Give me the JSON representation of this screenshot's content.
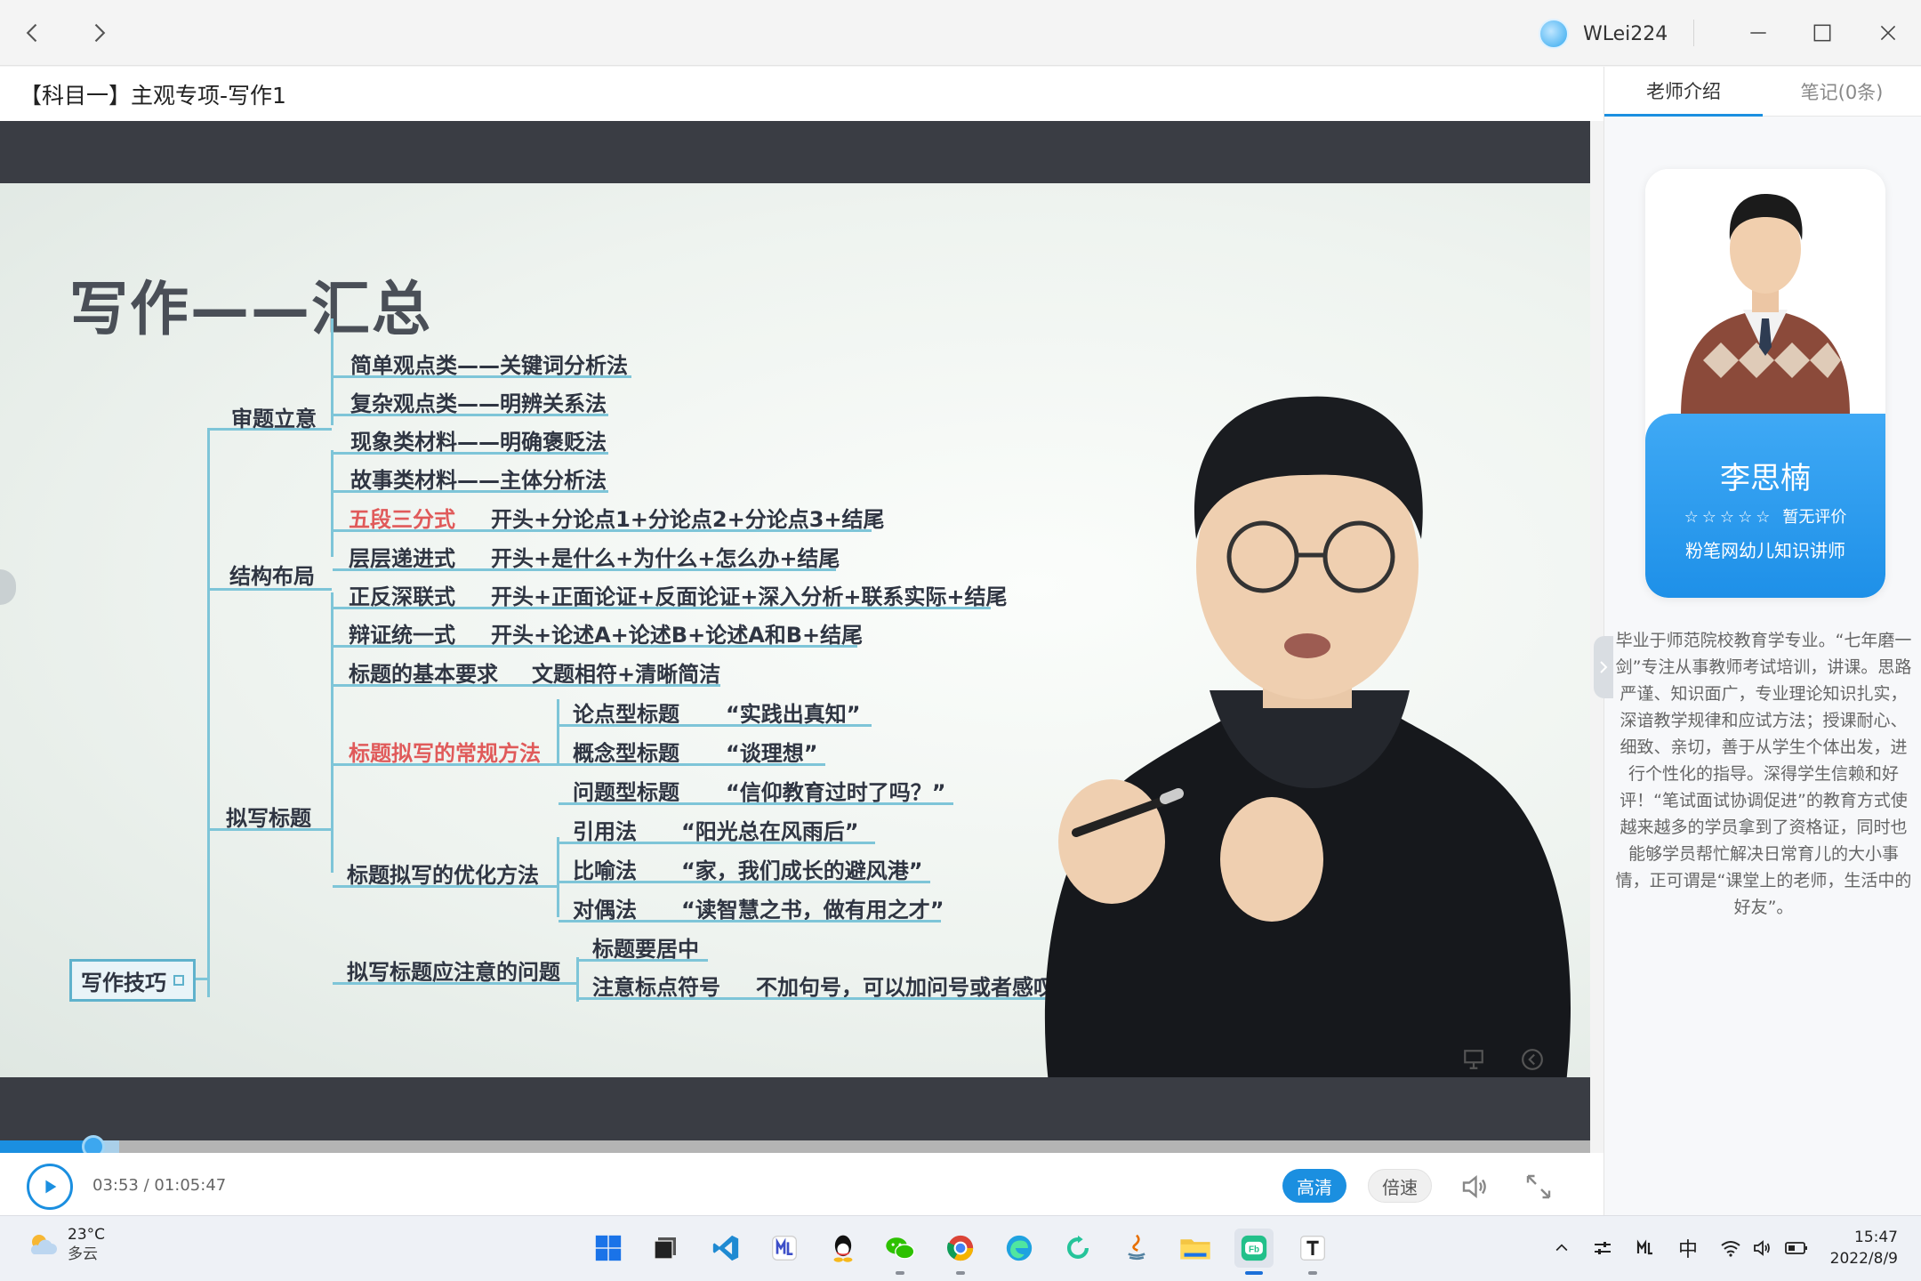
{
  "window": {
    "username": "WLei224"
  },
  "course": {
    "title": "【科目一】主观专项-写作1"
  },
  "slide": {
    "title": "写作——汇总",
    "root": "写作技巧",
    "branches": {
      "b1": "审题立意",
      "b2": "结构布局",
      "b3": "拟写标题"
    },
    "shenti": [
      "简单观点类——关键词分析法",
      "复杂观点类——明辨关系法",
      "现象类材料——明确褒贬法",
      "故事类材料——主体分析法"
    ],
    "jiegou": [
      {
        "name": "五段三分式",
        "desc": "开头+分论点1+分论点2+分论点3+结尾"
      },
      {
        "name": "层层递进式",
        "desc": "开头+是什么+为什么+怎么办+结尾"
      },
      {
        "name": "正反深联式",
        "desc": "开头+正面论证+反面论证+深入分析+联系实际+结尾"
      },
      {
        "name": "辩证统一式",
        "desc": "开头+论述A+论述B+论述A和B+结尾"
      }
    ],
    "biaoti": {
      "basic_label": "标题的基本要求",
      "basic_value": "文题相符+清晰简洁",
      "common_label": "标题拟写的常规方法",
      "common": [
        {
          "name": "论点型标题",
          "example": "“实践出真知”"
        },
        {
          "name": "概念型标题",
          "example": "“谈理想”"
        },
        {
          "name": "问题型标题",
          "example": "“信仰教育过时了吗？”"
        }
      ],
      "opt_label": "标题拟写的优化方法",
      "opt": [
        {
          "name": "引用法",
          "example": "“阳光总在风雨后”"
        },
        {
          "name": "比喻法",
          "example": "“家，我们成长的避风港”"
        },
        {
          "name": "对偶法",
          "example": "“读智慧之书，做有用之才”"
        }
      ],
      "notes_label": "拟写标题应注意的问题",
      "notes": [
        {
          "name": "标题要居中",
          "detail": ""
        },
        {
          "name": "注意标点符号",
          "detail": "不加句号，可以加问号或者感叹号"
        }
      ]
    }
  },
  "player": {
    "current_time": "03:53",
    "separator": " / ",
    "duration": "01:05:47",
    "progress_fraction": 0.0589,
    "buffer_fraction": 0.075,
    "quality_label": "高清",
    "speed_label": "倍速"
  },
  "right_panel": {
    "tabs": [
      "老师介绍",
      "笔记(0条)"
    ],
    "teacher": {
      "name": "李思楠",
      "stars": "☆☆☆☆☆",
      "rating_text": "暂无评价",
      "role": "粉笔网幼儿知识讲师",
      "bio": "毕业于师范院校教育学专业。“七年磨一剑”专注从事教师考试培训，讲课。思路严谨、知识面广，专业理论知识扎实，深谙教学规律和应试方法；授课耐心、细致、亲切，善于从学生个体出发，进行个性化的指导。深得学生信赖和好评！“笔试面试协调促进”的教育方式使越来越多的学员拿到了资格证，同时也能够学员帮忙解决日常育儿的大小事情，正可谓是“课堂上的老师，生活中的好友”。"
    }
  },
  "taskbar": {
    "temperature": "23°C",
    "condition": "多云",
    "ime": "中",
    "time": "15:47",
    "date": "2022/8/9",
    "apps": [
      "start-icon",
      "task-view-icon",
      "vscode-icon",
      "mindmap-icon",
      "qq-icon",
      "wechat-icon",
      "chrome-icon",
      "edge-icon",
      "refresh-app-icon",
      "java-icon",
      "file-explorer-icon",
      "fenbi-icon",
      "typora-icon"
    ]
  },
  "colors": {
    "accent": "#1b8fe0",
    "mindmap_line": "#7ec5d8",
    "mindmap_highlight": "#e05a5a"
  }
}
